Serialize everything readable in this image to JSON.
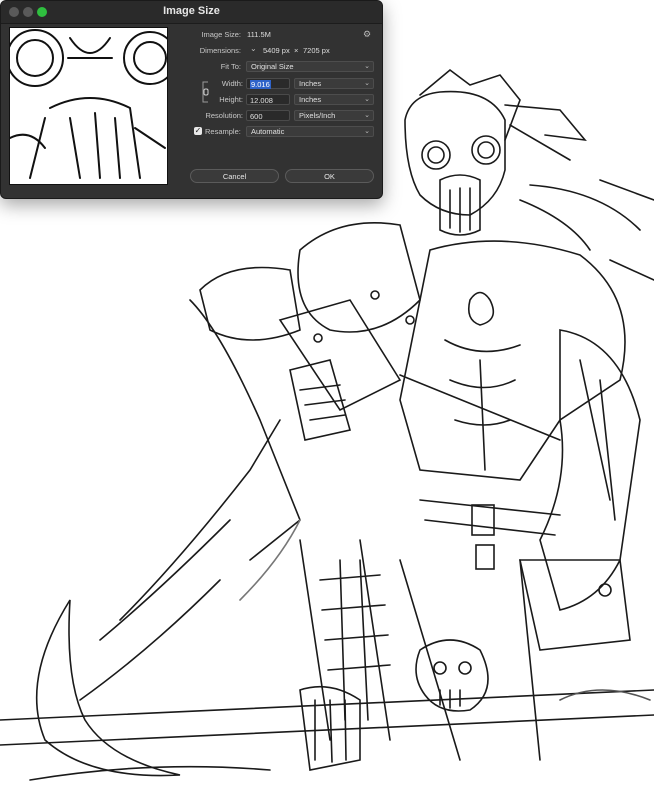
{
  "dialog": {
    "title": "Image Size",
    "image_size_label": "Image Size:",
    "image_size_value": "111.5M",
    "dimensions_label": "Dimensions:",
    "dimensions_width": "5409 px",
    "dimensions_sep": "×",
    "dimensions_height": "7205 px",
    "fit_to_label": "Fit To:",
    "fit_to_value": "Original Size",
    "width_label": "Width:",
    "width_value": "9.016",
    "width_unit": "Inches",
    "height_label": "Height:",
    "height_value": "12.008",
    "height_unit": "Inches",
    "resolution_label": "Resolution:",
    "resolution_value": "600",
    "resolution_unit": "Pixels/Inch",
    "resample_label": "Resample:",
    "resample_checked": true,
    "resample_value": "Automatic",
    "cancel_label": "Cancel",
    "ok_label": "OK"
  },
  "icons": {
    "gear": "gear-icon",
    "link": "link-icon",
    "chevron": "chevron-down-icon"
  },
  "colors": {
    "dialog_bg": "#323232",
    "selection": "#2f63c9",
    "zoom_button": "#2fbf3f"
  }
}
